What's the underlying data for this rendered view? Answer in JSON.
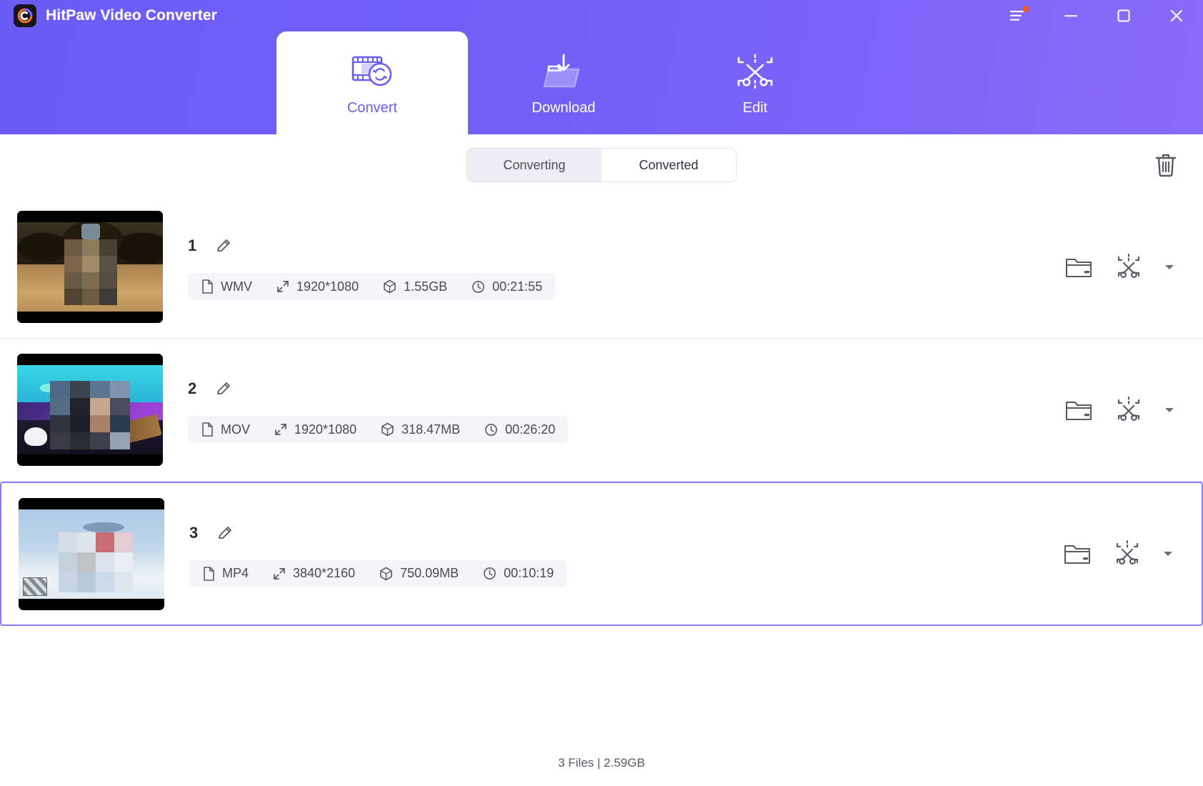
{
  "window": {
    "app_title": "HitPaw Video Converter",
    "logo_icon": "hitpaw-logo-icon",
    "controls": {
      "menu_icon": "hamburger-menu-icon",
      "menu_badge": "notification-dot",
      "minimize_icon": "minimize-icon",
      "maximize_icon": "maximize-icon",
      "close_icon": "close-icon"
    }
  },
  "tabs": [
    {
      "label": "Convert",
      "icon": "film-convert-icon",
      "active": true
    },
    {
      "label": "Download",
      "icon": "folder-download-icon",
      "active": false
    },
    {
      "label": "Edit",
      "icon": "scissors-crop-icon",
      "active": false
    }
  ],
  "subbar": {
    "segments": [
      {
        "label": "Converting",
        "active": false
      },
      {
        "label": "Converted",
        "active": true
      }
    ],
    "trash_icon": "trash-icon"
  },
  "files": [
    {
      "index": "1",
      "edit_icon": "pencil-icon",
      "format": "WMV",
      "resolution": "1920*1080",
      "size": "1.55GB",
      "duration": "00:21:55",
      "selected": false,
      "actions": {
        "folder_icon": "folder-open-icon",
        "edit_icon": "scissors-crop-icon",
        "caret_icon": "chevron-down-icon"
      }
    },
    {
      "index": "2",
      "edit_icon": "pencil-icon",
      "format": "MOV",
      "resolution": "1920*1080",
      "size": "318.47MB",
      "duration": "00:26:20",
      "selected": false,
      "actions": {
        "folder_icon": "folder-open-icon",
        "edit_icon": "scissors-crop-icon",
        "caret_icon": "chevron-down-icon"
      }
    },
    {
      "index": "3",
      "edit_icon": "pencil-icon",
      "format": "MP4",
      "resolution": "3840*2160",
      "size": "750.09MB",
      "duration": "00:10:19",
      "selected": true,
      "actions": {
        "folder_icon": "folder-open-icon",
        "edit_icon": "scissors-crop-icon",
        "caret_icon": "chevron-down-icon"
      }
    }
  ],
  "meta_icons": {
    "format": "file-icon",
    "resolution": "resize-icon",
    "size": "cube-icon",
    "duration": "clock-icon"
  },
  "footer": {
    "status": "3 Files | 2.59GB"
  },
  "colors": {
    "header_gradient_start": "#6a5cf5",
    "header_gradient_end": "#8a6cf9",
    "accent": "#6a5cf5",
    "selected_border": "#8a7cf8",
    "badge": "#f4571f",
    "meta_strip_bg": "#f5f4f9"
  }
}
